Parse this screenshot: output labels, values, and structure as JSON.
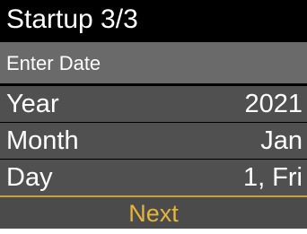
{
  "header": {
    "title": "Startup 3/3"
  },
  "subheader": {
    "label": "Enter Date"
  },
  "fields": [
    {
      "label": "Year",
      "value": "2021"
    },
    {
      "label": "Month",
      "value": "Jan"
    },
    {
      "label": "Day",
      "value": "1, Fri"
    }
  ],
  "footer": {
    "next_label": "Next"
  },
  "colors": {
    "background": "#000000",
    "subheader": "#6a6a6a",
    "row": "#505050",
    "accent_line": "#c8a13a",
    "next_text": "#e6b53a"
  }
}
